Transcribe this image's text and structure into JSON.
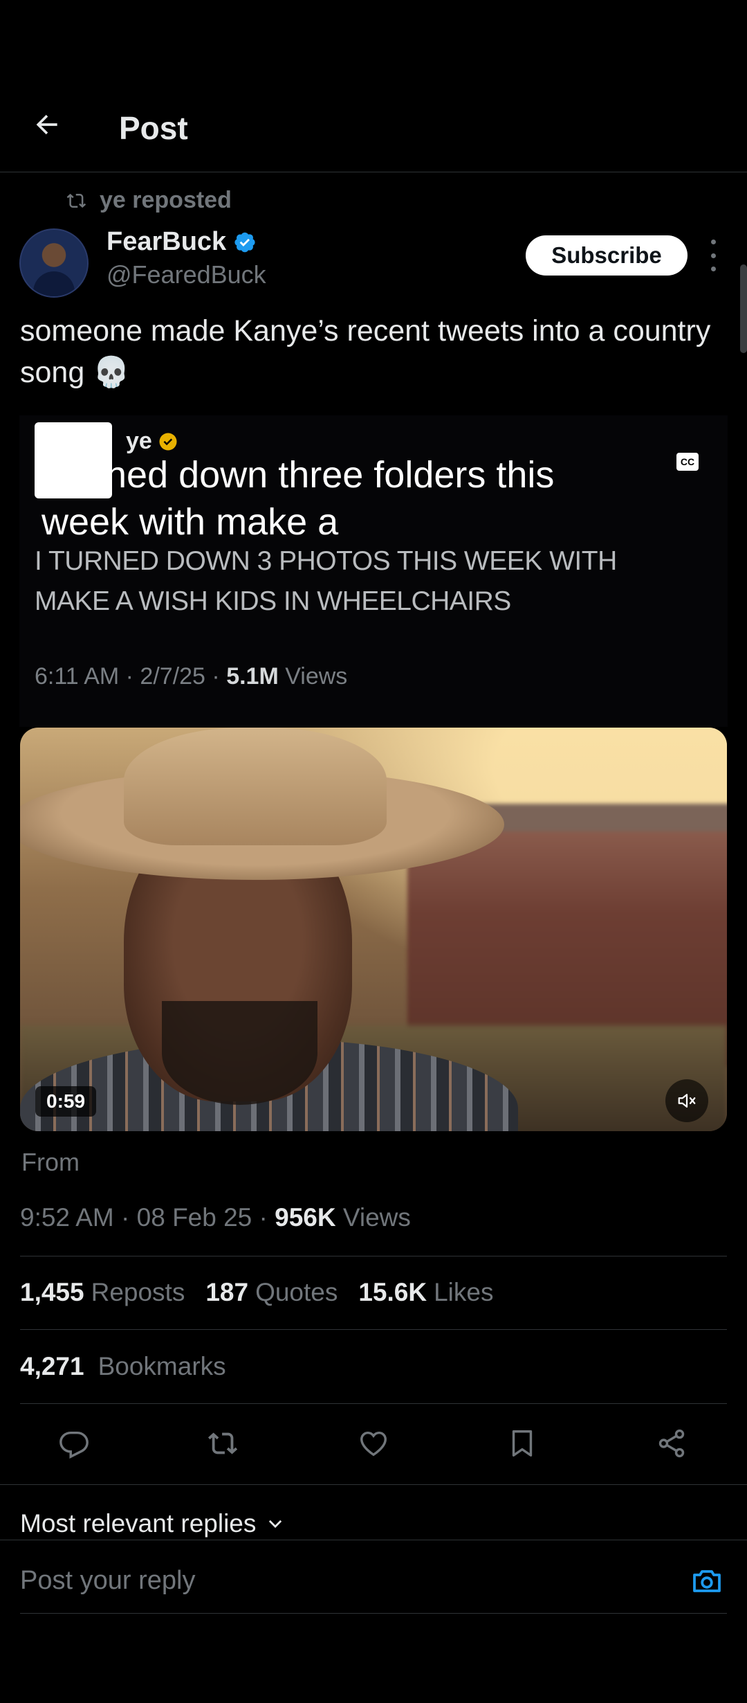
{
  "header": {
    "title": "Post",
    "back_icon": "arrow-left-icon"
  },
  "repost": {
    "text": "ye reposted"
  },
  "author": {
    "name": "FearBuck",
    "handle": "@FearedBuck",
    "verified_color": "#1d9bf0"
  },
  "subscribe_label": "Subscribe",
  "post": {
    "text": "someone made Kanye’s recent tweets into a country song 💀"
  },
  "embed": {
    "name": "ye",
    "caption": "I turned down three folders this week with make a",
    "cc_label": "CC",
    "tweet_text": "I TURNED DOWN 3 PHOTOS THIS WEEK WITH MAKE A WISH KIDS IN WHEELCHAIRS",
    "meta_prefix": "6:11 AM · 2/7/25 · ",
    "meta_views_count": "5.1M",
    "meta_views_label": " Views"
  },
  "video": {
    "duration": "0:59",
    "muted": true
  },
  "from_label": "From",
  "timestamp": {
    "time": "9:52 AM · 08 Feb 25 · ",
    "views_count": "956K",
    "views_label": " Views"
  },
  "stats": {
    "reposts_count": "1,455",
    "reposts_label": "Reposts",
    "quotes_count": "187",
    "quotes_label": "Quotes",
    "likes_count": "15.6K",
    "likes_label": "Likes"
  },
  "bookmarks": {
    "count": "4,271",
    "label": "Bookmarks"
  },
  "replies": {
    "sort_label": "Most relevant replies",
    "input_placeholder": "Post your reply"
  },
  "colors": {
    "accent": "#1d9bf0",
    "background": "#000000",
    "muted": "#71767b"
  }
}
